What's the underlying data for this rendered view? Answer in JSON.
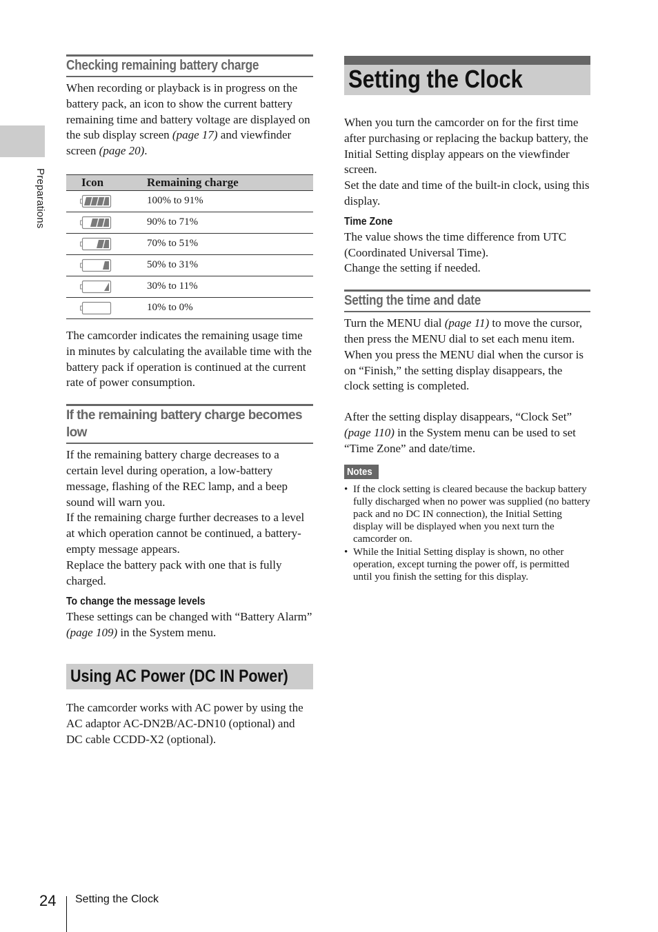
{
  "side_tab": {
    "label": "Preparations"
  },
  "left": {
    "checking": {
      "heading": "Checking remaining battery charge",
      "intro_parts": [
        "When recording or playback is in progress on the battery pack, an icon to show the current battery remaining time and battery voltage are displayed on the sub display screen ",
        "(page 17)",
        " and viewfinder screen ",
        "(page 20)",
        "."
      ],
      "table": {
        "headers": [
          "Icon",
          "Remaining charge"
        ],
        "rows": [
          {
            "icon": "battery-4-bars-icon",
            "bars": 4,
            "label": "100% to 91%"
          },
          {
            "icon": "battery-3-bars-icon",
            "bars": 3,
            "label": "90% to 71%"
          },
          {
            "icon": "battery-2-bars-icon",
            "bars": 2,
            "label": "70% to 51%"
          },
          {
            "icon": "battery-1-bar-icon",
            "bars": 1,
            "label": "50% to 31%"
          },
          {
            "icon": "battery-low-icon",
            "bars": 0.5,
            "label": "30% to 11%"
          },
          {
            "icon": "battery-empty-icon",
            "bars": 0,
            "label": "10% to 0%"
          }
        ]
      },
      "after_table": "The camcorder indicates the remaining usage time in minutes by calculating the available time with the battery pack if operation is continued at the current rate of power consumption."
    },
    "low": {
      "heading": "If the remaining battery charge becomes low",
      "paragraphs": [
        "If the remaining battery charge decreases to a certain level during operation, a low-battery message, flashing of the REC lamp, and a beep sound will warn you.",
        "If the remaining charge further decreases to a level at which operation cannot be continued, a battery-empty message appears.",
        "Replace the battery pack with one that is fully charged."
      ],
      "subheading": "To change the message levels",
      "sub_parts": [
        " These settings can be changed with “Battery Alarm” ",
        "(page 109)",
        " in the System menu."
      ]
    },
    "ac_power": {
      "title": "Using AC Power (DC IN Power)",
      "text": "The camcorder works with AC power by using the AC adaptor AC-DN2B/AC-DN10 (optional) and DC cable CCDD-X2 (optional)."
    }
  },
  "right": {
    "title": "Setting the Clock",
    "intro": [
      "When you turn the camcorder on for the first time after purchasing or replacing the backup battery, the Initial Setting display appears on the viewfinder screen.",
      "Set the date and time of the built-in clock, using this display."
    ],
    "time_zone": {
      "heading": "Time Zone",
      "lines": [
        "The value shows the time difference from UTC (Coordinated Universal Time).",
        "Change the setting if needed."
      ]
    },
    "time_date": {
      "heading": "Setting the time and date",
      "p1_parts": [
        "Turn the MENU dial ",
        "(page 11)",
        " to move the cursor, then press the MENU dial to set each menu item. When you press the MENU dial when the cursor is on “Finish,” the setting display disappears, the clock setting is completed."
      ],
      "p2_parts": [
        "After the setting display disappears, “Clock Set” ",
        "(page 110)",
        " in the System menu can be used to set “Time Zone” and date/time."
      ]
    },
    "notes": {
      "label": "Notes",
      "items": [
        "If the clock setting is cleared because the backup battery fully discharged when no power was supplied (no battery pack and no DC IN connection), the Initial Setting display will be displayed when you next turn the camcorder on.",
        "While the Initial Setting display is shown, no other operation, except turning the power off, is permitted until you finish the setting for this display."
      ]
    }
  },
  "footer": {
    "page_number": "24",
    "section": "Setting the Clock"
  },
  "colors": {
    "heading_gray": "#666666",
    "band_gray": "#cccccc",
    "icon_fill": "#7a7a7a"
  }
}
